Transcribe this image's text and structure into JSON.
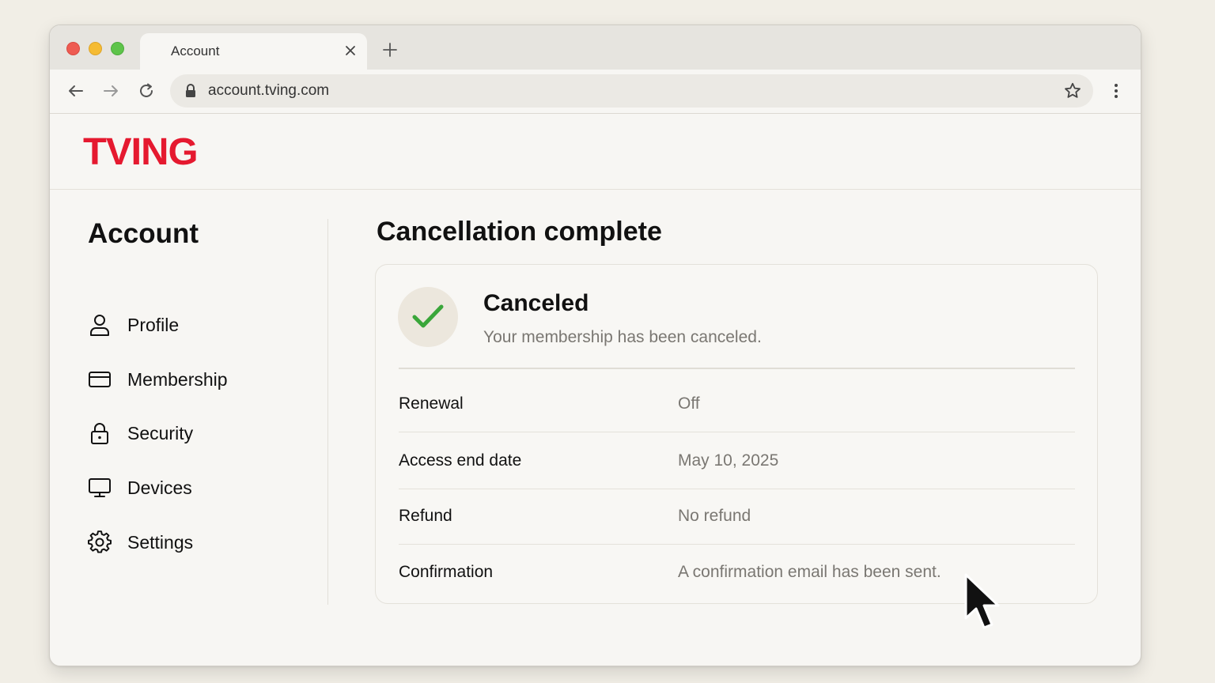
{
  "browser": {
    "tab_title": "Account",
    "url": "account.tving.com"
  },
  "site": {
    "logo_text": "TVING",
    "brand_color": "#e5192f"
  },
  "sidebar": {
    "title": "Account",
    "items": [
      {
        "label": "Profile",
        "icon": "person-icon"
      },
      {
        "label": "Membership",
        "icon": "card-icon"
      },
      {
        "label": "Security",
        "icon": "lock-icon"
      },
      {
        "label": "Devices",
        "icon": "monitor-icon"
      },
      {
        "label": "Settings",
        "icon": "gear-icon"
      }
    ]
  },
  "main": {
    "title": "Cancellation complete",
    "status": {
      "title": "Canceled",
      "subtitle": "Your membership has been canceled.",
      "icon": "checkmark-icon",
      "icon_color": "#3aa63a"
    },
    "details": [
      {
        "label": "Renewal",
        "value": "Off"
      },
      {
        "label": "Access end date",
        "value": "May 10, 2025"
      },
      {
        "label": "Refund",
        "value": "No refund"
      },
      {
        "label": "Confirmation",
        "value": "A confirmation email has been sent."
      }
    ]
  }
}
